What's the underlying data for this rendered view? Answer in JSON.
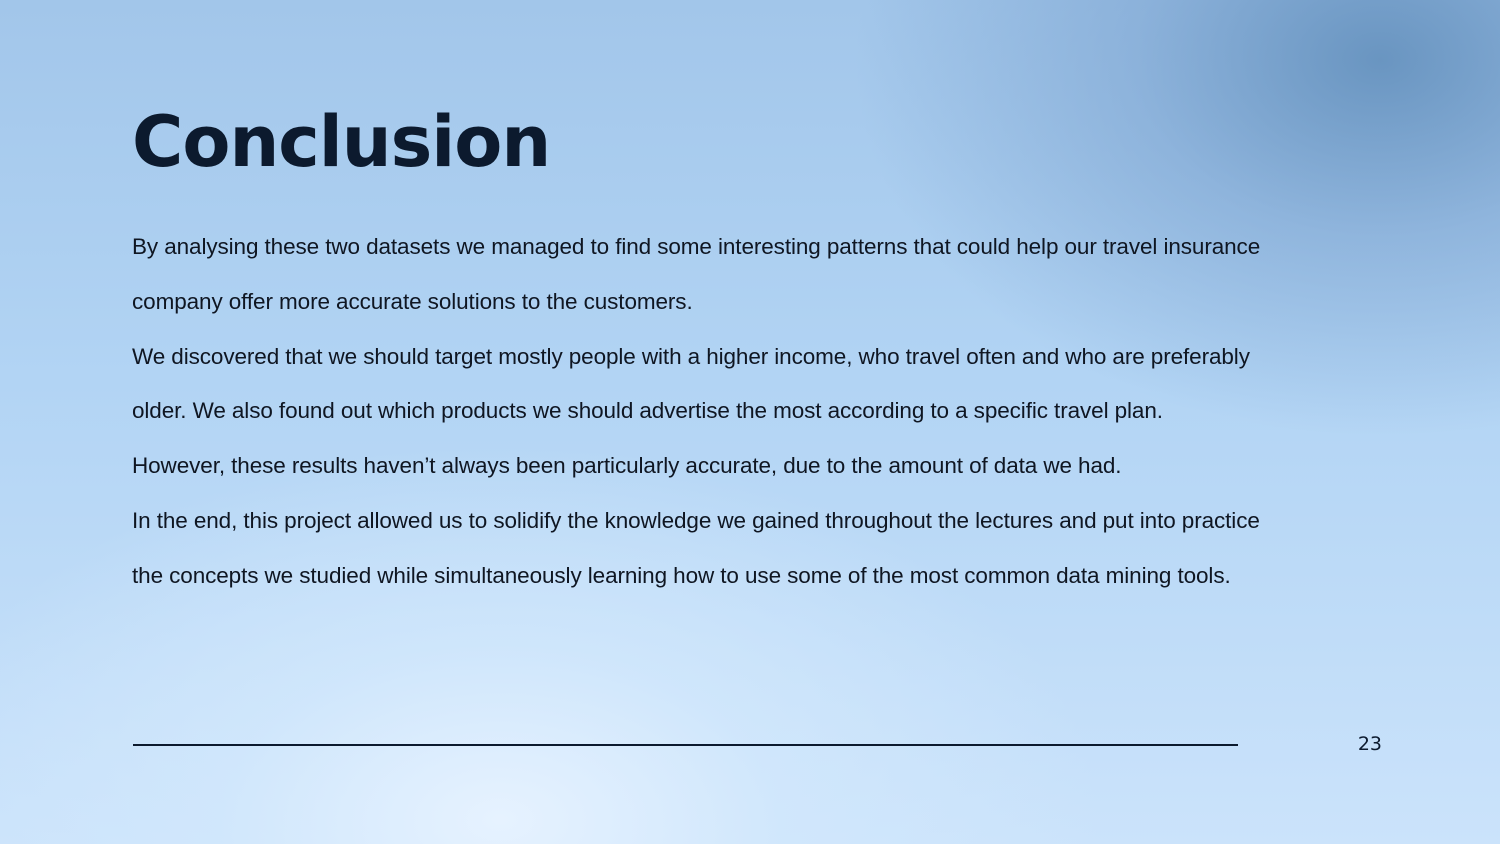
{
  "slide": {
    "title": "Conclusion",
    "paragraphs": [
      "By analysing these two datasets we managed to find some interesting patterns that could help our travel insurance company offer more accurate solutions to the customers.",
      "We discovered that we should target mostly people with a higher income, who travel often and who are preferably older. We also found out which products we should advertise the most according to a specific travel plan.",
      "However, these results haven’t always been particularly accurate, due to the amount of data we had.",
      "In the end, this project allowed us to solidify the knowledge we gained throughout the lectures and put into practice the concepts we studied while simultaneously learning how to use some of the most common data mining tools."
    ],
    "page_number": "23"
  }
}
